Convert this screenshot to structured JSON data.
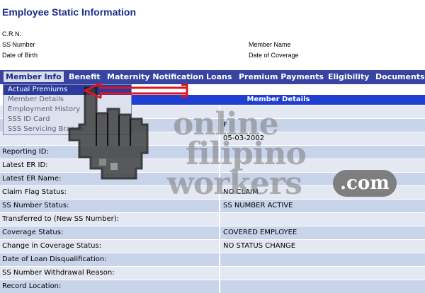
{
  "page": {
    "title": "Employee Static Information"
  },
  "info": {
    "crn_label": "C.R.N.",
    "ss_label": "SS Number",
    "dob_label": "Date of Birth",
    "member_name_label": "Member Name",
    "coverage_label": "Date of Coverage"
  },
  "nav": {
    "items": [
      {
        "label": "Member Info"
      },
      {
        "label": "Benefit"
      },
      {
        "label": "Maternity Notification"
      },
      {
        "label": "Loans"
      },
      {
        "label": "Premium Payments"
      },
      {
        "label": "Eligibility"
      },
      {
        "label": "Documents"
      }
    ]
  },
  "dropdown": {
    "items": [
      {
        "label": "Actual Premiums"
      },
      {
        "label": "Member Details"
      },
      {
        "label": "Employment History"
      },
      {
        "label": "SSS ID Card"
      },
      {
        "label": "SSS Servicing Branch"
      }
    ]
  },
  "member_details": {
    "header": "Member Details",
    "rows": [
      {
        "label": "",
        "value": ""
      },
      {
        "label": "",
        "value": "F"
      },
      {
        "label": "",
        "value": "05-03-2002"
      },
      {
        "label": "Reporting ID:",
        "value": ""
      },
      {
        "label": "Latest ER ID:",
        "value": ""
      },
      {
        "label": "Latest ER Name:",
        "value": ""
      },
      {
        "label": "Claim Flag Status:",
        "value": "NO CLAIM"
      },
      {
        "label": "SS Number Status:",
        "value": "SS NUMBER ACTIVE"
      },
      {
        "label": "Transferred to (New SS Number):",
        "value": ""
      },
      {
        "label": "Coverage Status:",
        "value": "COVERED EMPLOYEE"
      },
      {
        "label": "Change in Coverage Status:",
        "value": "NO STATUS CHANGE"
      },
      {
        "label": "Date of Loan Disqualification:",
        "value": ""
      },
      {
        "label": "SS Number Withdrawal Reason:",
        "value": ""
      },
      {
        "label": "Record Location:",
        "value": ""
      }
    ]
  },
  "watermark": {
    "line1": "online",
    "line2": "filipino",
    "line3": "workers",
    "suffix": ".com"
  },
  "colors": {
    "nav_bg": "#3845a0",
    "header_bg": "#1f3fd1",
    "title": "#1b2a8c",
    "arrow": "#e0141e"
  }
}
